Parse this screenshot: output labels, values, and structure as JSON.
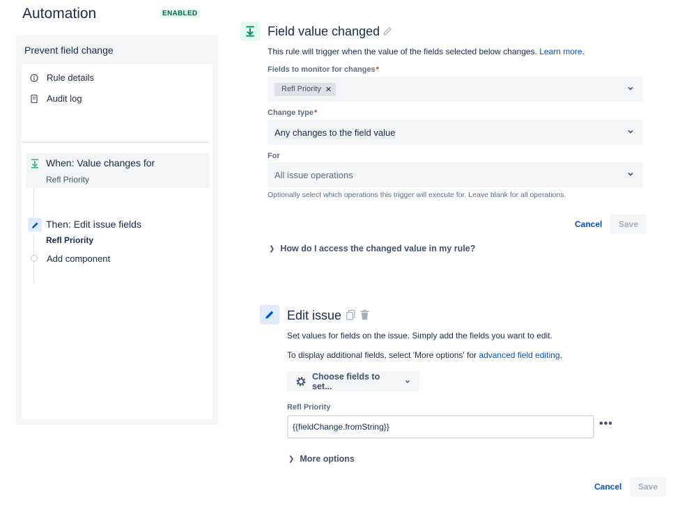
{
  "header": {
    "title": "Automation",
    "status": "ENABLED"
  },
  "sidebar": {
    "rule_name": "Prevent field change",
    "nav": [
      {
        "label": "Rule details",
        "icon": "info-icon"
      },
      {
        "label": "Audit log",
        "icon": "document-icon"
      }
    ],
    "trigger": {
      "title": "When: Value changes for",
      "subtitle": "Refl Priority",
      "icon": "trigger-icon"
    },
    "action": {
      "title": "Then: Edit issue fields",
      "subtitle": "Refl Priority",
      "icon": "pencil-icon"
    },
    "add_component": "Add component"
  },
  "trigger_config": {
    "title": "Field value changed",
    "description": "This rule will trigger when the value of the fields selected below changes.",
    "learn_more": "Learn more.",
    "fields_label": "Fields to monitor for changes",
    "fields_chips": [
      "Refl Priority"
    ],
    "change_type_label": "Change type",
    "change_type_value": "Any changes to the field value",
    "for_label": "For",
    "for_value": "All issue operations",
    "for_helper": "Optionally select which operations this trigger will execute for. Leave blank for all operations.",
    "cancel": "Cancel",
    "save": "Save",
    "expander": "How do I access the changed value in my rule?"
  },
  "edit_issue": {
    "title": "Edit issue",
    "desc1": "Set values for fields on the issue. Simply add the fields you want to edit.",
    "desc2_prefix": "To display additional fields, select 'More options' for",
    "desc2_link": "advanced field editing",
    "desc2_suffix": ".",
    "choose_fields": "Choose fields to set...",
    "field_label": "Refl Priority",
    "field_value": "{{fieldChange.fromString}}",
    "more_options": "More options",
    "cancel": "Cancel",
    "save": "Save"
  },
  "colors": {
    "accent": "#0052cc",
    "success_bg": "#e3fcef",
    "success_text": "#006644",
    "action_bg": "#deebff"
  }
}
